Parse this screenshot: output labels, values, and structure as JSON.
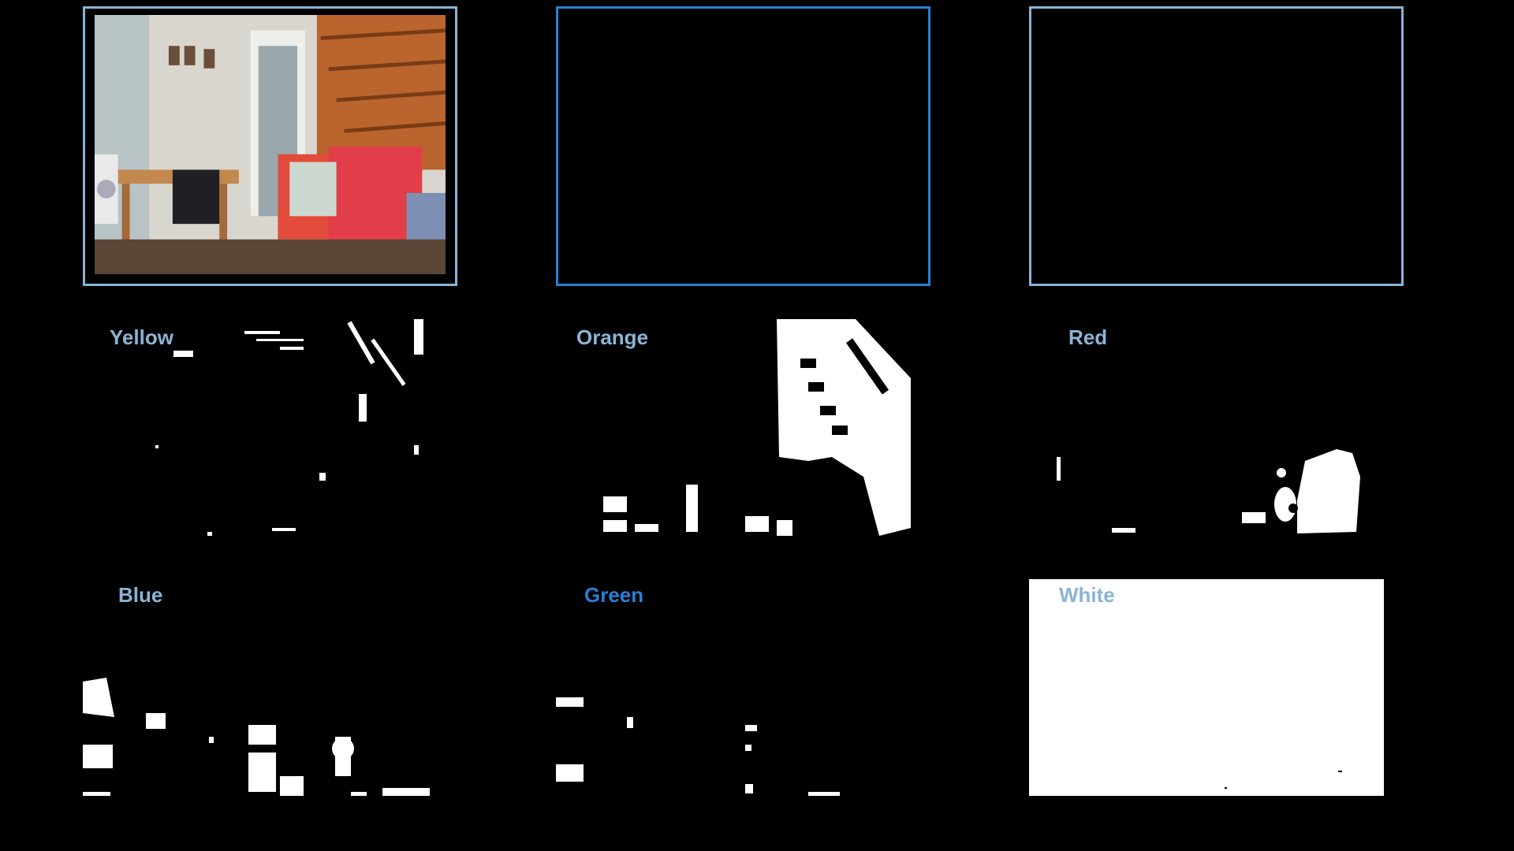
{
  "cameras": [
    {
      "id": "cam-1",
      "content": "room-snapshot",
      "selected": false
    },
    {
      "id": "cam-2",
      "content": "blank",
      "selected": true
    },
    {
      "id": "cam-3",
      "content": "blank",
      "selected": false
    }
  ],
  "masks": {
    "yellow": {
      "label": "Yellow"
    },
    "orange": {
      "label": "Orange"
    },
    "red": {
      "label": "Red"
    },
    "blue": {
      "label": "Blue"
    },
    "green": {
      "label": "Green"
    },
    "white": {
      "label": "White"
    }
  },
  "colors": {
    "frame_border": "#8ab4d4",
    "frame_border_selected": "#2a7fd4",
    "label": "#8ab4d4",
    "label_active": "#2a7fd4",
    "background": "#000000"
  }
}
